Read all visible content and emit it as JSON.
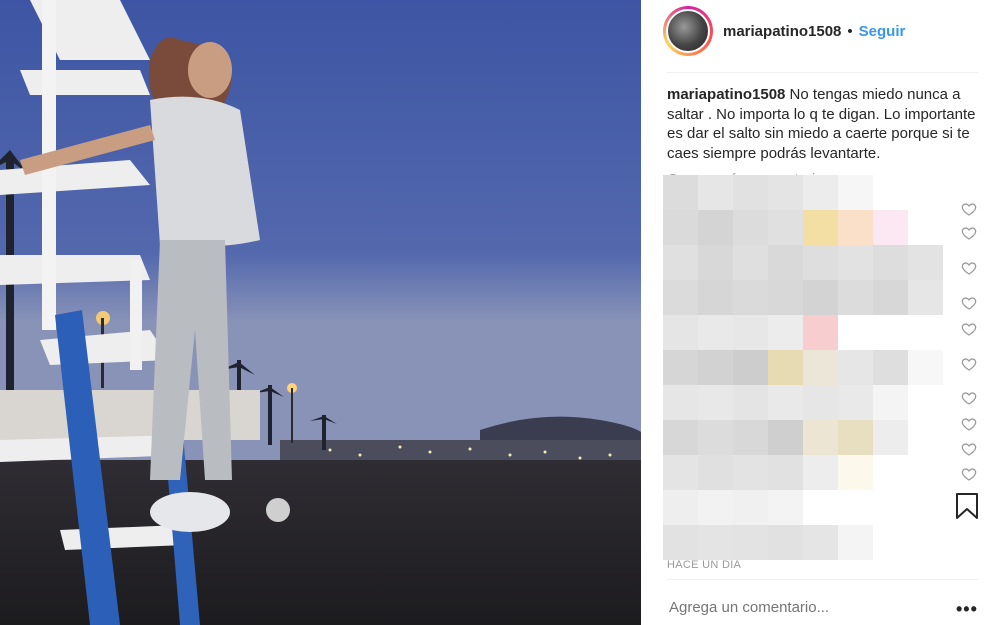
{
  "post": {
    "username": "mariapatino1508",
    "separator": "•",
    "follow_label": "Seguir",
    "caption_user": "mariapatino1508",
    "caption_text": " No tengas miedo nunca a saltar . No importa lo q te digan. Lo importante es dar el salto sin miedo a caerte porque si te caes siempre podrás levantarte.",
    "more_comments": "Cargar más comentarios",
    "date": "HACE UN DIA",
    "comment_placeholder": "Agrega un comentario...",
    "more_options": "•••"
  },
  "icons": [
    "heart-icon",
    "bookmark-icon",
    "more-options-icon"
  ],
  "colors": {
    "follow": "#3897f0",
    "text": "#262626",
    "muted": "#999999",
    "divider": "#efefef"
  }
}
